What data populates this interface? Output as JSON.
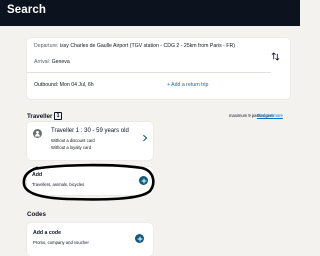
{
  "header": {
    "title": "Search"
  },
  "trip": {
    "departure_label": "Departure:",
    "departure_value": "issy Charles de Gaulle Airport (TGV station - CDG 2 - 25km from Paris - FR)",
    "arrival_label": "Arrival:",
    "arrival_value": "Geneva",
    "outbound": "Outbound: Mon 04 Jul, 6h",
    "add_return": "+ Add a return trip",
    "swap_icon": "swap-vertical-icon"
  },
  "travellers": {
    "title": "Traveller",
    "count": "1",
    "max_passengers": "maximum 9 passengers",
    "find_out_more": "Find out more",
    "items": [
      {
        "name": "Traveller 1 : 30 - 59 years old",
        "discount": "Without a discount card",
        "loyalty": "Without a loyalty card"
      }
    ]
  },
  "add_section": {
    "title": "Add",
    "subtitle": "Travellers, animals, bicycles"
  },
  "codes": {
    "title": "Codes",
    "card_title": "Add a code",
    "card_subtitle": "Promo, company and voucher"
  },
  "colors": {
    "header_bg": "#0c131f",
    "page_bg": "#f3f2ef",
    "accent": "#0b5a80",
    "link": "#0071c9"
  }
}
